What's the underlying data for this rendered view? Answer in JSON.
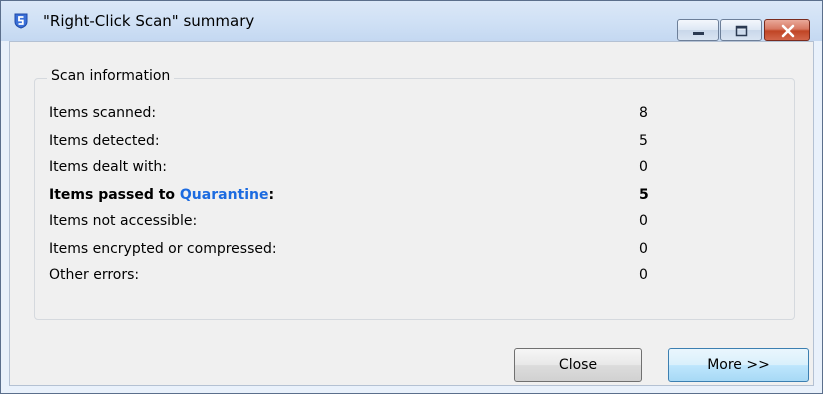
{
  "window": {
    "title": "\"Right-Click Scan\" summary",
    "icon": "shield-s-icon",
    "controls": [
      "minimize-icon",
      "maximize-icon",
      "close-icon"
    ]
  },
  "scan_info": {
    "group_label": "Scan information",
    "rows": [
      {
        "label": "Items scanned:",
        "value": "8"
      },
      {
        "label": "Items detected:",
        "value": "5"
      },
      {
        "label": "Items dealt with:",
        "value": "0"
      },
      {
        "label_prefix": "Items passed to ",
        "label_link": "Quarantine",
        "label_suffix": ":",
        "value": "5"
      },
      {
        "label": "Items not accessible:",
        "value": "0"
      },
      {
        "label": "Items encrypted or compressed:",
        "value": "0"
      },
      {
        "label": "Other errors:",
        "value": "0"
      }
    ]
  },
  "buttons": {
    "close_label": "Close",
    "more_label": "More >>"
  },
  "colors": {
    "link": "#1c6be0",
    "app_icon": "#3a6fd8",
    "close_button": "#c94a2a"
  }
}
